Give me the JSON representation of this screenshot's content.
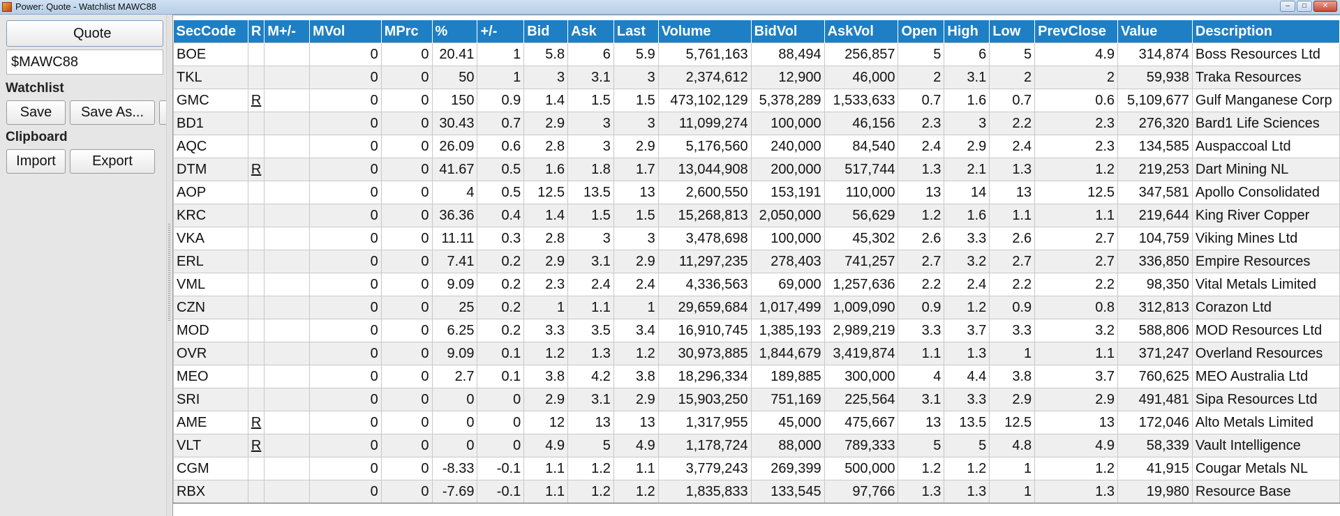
{
  "window": {
    "title": "Power: Quote - Watchlist MAWC88",
    "controls": [
      "minimize-icon",
      "maximize-icon",
      "close-icon"
    ]
  },
  "left_panel": {
    "quote_button": "Quote",
    "symbol_value": "$MAWC88",
    "watchlist_label": "Watchlist",
    "save_label": "Save",
    "save_as_label": "Save As...",
    "clipboard_label": "Clipboard",
    "import_label": "Import",
    "export_label": "Export"
  },
  "table": {
    "columns": [
      "SecCode",
      "R",
      "M+/-",
      "MVol",
      "MPrc",
      "%",
      "+/-",
      "Bid",
      "Ask",
      "Last",
      "Volume",
      "BidVol",
      "AskVol",
      "Open",
      "High",
      "Low",
      "PrevClose",
      "Value",
      "Description"
    ],
    "colors": {
      "positive": "#1a9a1a",
      "negative": "#c01010",
      "header": "#1e7fc4"
    },
    "rows": [
      [
        "BOE",
        "",
        "",
        "0",
        "0",
        "20.41",
        "1",
        "5.8",
        "6",
        "5.9",
        "5,761,163",
        "88,494",
        "256,857",
        "5",
        "6",
        "5",
        "4.9",
        "314,874",
        "Boss Resources Ltd"
      ],
      [
        "TKL",
        "",
        "",
        "0",
        "0",
        "50",
        "1",
        "3",
        "3.1",
        "3",
        "2,374,612",
        "12,900",
        "46,000",
        "2",
        "3.1",
        "2",
        "2",
        "59,938",
        "Traka Resources"
      ],
      [
        "GMC",
        "R",
        "",
        "0",
        "0",
        "150",
        "0.9",
        "1.4",
        "1.5",
        "1.5",
        "473,102,129",
        "5,378,289",
        "1,533,633",
        "0.7",
        "1.6",
        "0.7",
        "0.6",
        "5,109,677",
        "Gulf Manganese Corp"
      ],
      [
        "BD1",
        "",
        "",
        "0",
        "0",
        "30.43",
        "0.7",
        "2.9",
        "3",
        "3",
        "11,099,274",
        "100,000",
        "46,156",
        "2.3",
        "3",
        "2.2",
        "2.3",
        "276,320",
        "Bard1 Life Sciences"
      ],
      [
        "AQC",
        "",
        "",
        "0",
        "0",
        "26.09",
        "0.6",
        "2.8",
        "3",
        "2.9",
        "5,176,560",
        "240,000",
        "84,540",
        "2.4",
        "2.9",
        "2.4",
        "2.3",
        "134,585",
        "Auspaccoal Ltd"
      ],
      [
        "DTM",
        "R",
        "",
        "0",
        "0",
        "41.67",
        "0.5",
        "1.6",
        "1.8",
        "1.7",
        "13,044,908",
        "200,000",
        "517,744",
        "1.3",
        "2.1",
        "1.3",
        "1.2",
        "219,253",
        "Dart Mining NL"
      ],
      [
        "AOP",
        "",
        "",
        "0",
        "0",
        "4",
        "0.5",
        "12.5",
        "13.5",
        "13",
        "2,600,550",
        "153,191",
        "110,000",
        "13",
        "14",
        "13",
        "12.5",
        "347,581",
        "Apollo Consolidated"
      ],
      [
        "KRC",
        "",
        "",
        "0",
        "0",
        "36.36",
        "0.4",
        "1.4",
        "1.5",
        "1.5",
        "15,268,813",
        "2,050,000",
        "56,629",
        "1.2",
        "1.6",
        "1.1",
        "1.1",
        "219,644",
        "King River Copper"
      ],
      [
        "VKA",
        "",
        "",
        "0",
        "0",
        "11.11",
        "0.3",
        "2.8",
        "3",
        "3",
        "3,478,698",
        "100,000",
        "45,302",
        "2.6",
        "3.3",
        "2.6",
        "2.7",
        "104,759",
        "Viking Mines Ltd"
      ],
      [
        "ERL",
        "",
        "",
        "0",
        "0",
        "7.41",
        "0.2",
        "2.9",
        "3.1",
        "2.9",
        "11,297,235",
        "278,403",
        "741,257",
        "2.7",
        "3.2",
        "2.7",
        "2.7",
        "336,850",
        "Empire Resources"
      ],
      [
        "VML",
        "",
        "",
        "0",
        "0",
        "9.09",
        "0.2",
        "2.3",
        "2.4",
        "2.4",
        "4,336,563",
        "69,000",
        "1,257,636",
        "2.2",
        "2.4",
        "2.2",
        "2.2",
        "98,350",
        "Vital Metals Limited"
      ],
      [
        "CZN",
        "",
        "",
        "0",
        "0",
        "25",
        "0.2",
        "1",
        "1.1",
        "1",
        "29,659,684",
        "1,017,499",
        "1,009,090",
        "0.9",
        "1.2",
        "0.9",
        "0.8",
        "312,813",
        "Corazon Ltd"
      ],
      [
        "MOD",
        "",
        "",
        "0",
        "0",
        "6.25",
        "0.2",
        "3.3",
        "3.5",
        "3.4",
        "16,910,745",
        "1,385,193",
        "2,989,219",
        "3.3",
        "3.7",
        "3.3",
        "3.2",
        "588,806",
        "MOD Resources Ltd"
      ],
      [
        "OVR",
        "",
        "",
        "0",
        "0",
        "9.09",
        "0.1",
        "1.2",
        "1.3",
        "1.2",
        "30,973,885",
        "1,844,679",
        "3,419,874",
        "1.1",
        "1.3",
        "1",
        "1.1",
        "371,247",
        "Overland Resources"
      ],
      [
        "MEO",
        "",
        "",
        "0",
        "0",
        "2.7",
        "0.1",
        "3.8",
        "4.2",
        "3.8",
        "18,296,334",
        "189,885",
        "300,000",
        "4",
        "4.4",
        "3.8",
        "3.7",
        "760,625",
        "MEO Australia Ltd"
      ],
      [
        "SRI",
        "",
        "",
        "0",
        "0",
        "0",
        "0",
        "2.9",
        "3.1",
        "2.9",
        "15,903,250",
        "751,169",
        "225,564",
        "3.1",
        "3.3",
        "2.9",
        "2.9",
        "491,481",
        "Sipa Resources Ltd"
      ],
      [
        "AME",
        "R",
        "",
        "0",
        "0",
        "0",
        "0",
        "12",
        "13",
        "13",
        "1,317,955",
        "45,000",
        "475,667",
        "13",
        "13.5",
        "12.5",
        "13",
        "172,046",
        "Alto Metals Limited"
      ],
      [
        "VLT",
        "R",
        "",
        "0",
        "0",
        "0",
        "0",
        "4.9",
        "5",
        "4.9",
        "1,178,724",
        "88,000",
        "789,333",
        "5",
        "5",
        "4.8",
        "4.9",
        "58,339",
        "Vault Intelligence"
      ],
      [
        "CGM",
        "",
        "",
        "0",
        "0",
        "-8.33",
        "-0.1",
        "1.1",
        "1.2",
        "1.1",
        "3,779,243",
        "269,399",
        "500,000",
        "1.2",
        "1.2",
        "1",
        "1.2",
        "41,915",
        "Cougar Metals NL"
      ],
      [
        "RBX",
        "",
        "",
        "0",
        "0",
        "-7.69",
        "-0.1",
        "1.1",
        "1.2",
        "1.2",
        "1,835,833",
        "133,545",
        "97,766",
        "1.3",
        "1.3",
        "1",
        "1.3",
        "19,980",
        "Resource Base"
      ]
    ],
    "selected_row": 19
  }
}
